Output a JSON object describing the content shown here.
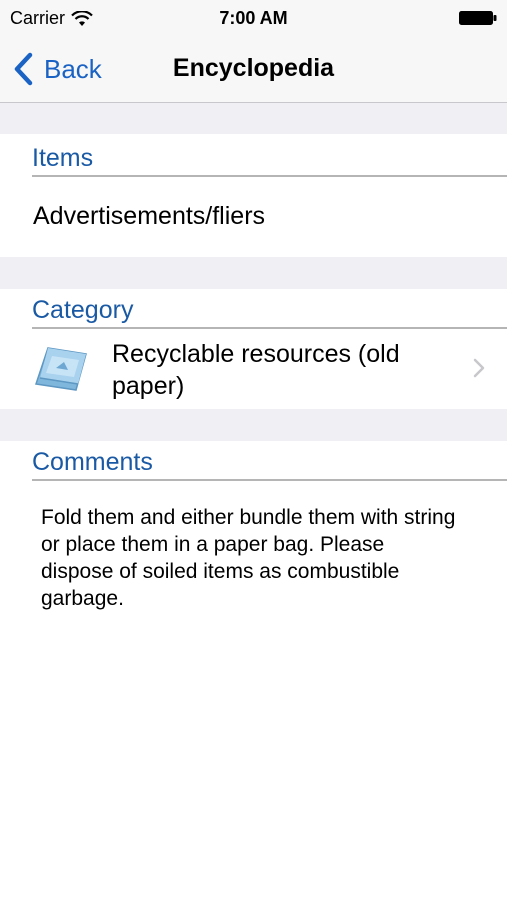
{
  "status_bar": {
    "carrier": "Carrier",
    "time": "7:00 AM"
  },
  "nav": {
    "back_label": "Back",
    "title": "Encyclopedia"
  },
  "items_section": {
    "header": "Items",
    "value": "Advertisements/fliers"
  },
  "category_section": {
    "header": "Category",
    "value": "Recyclable resources (old paper)",
    "icon": "paper-bundle-icon"
  },
  "comments_section": {
    "header": "Comments",
    "text": "Fold them and either bundle them with string or place them in a paper bag. Please dispose of soiled items as combustible garbage."
  },
  "colors": {
    "accent": "#1a63c4",
    "section_header": "#1a5aa5",
    "group_background": "#efeff4"
  }
}
